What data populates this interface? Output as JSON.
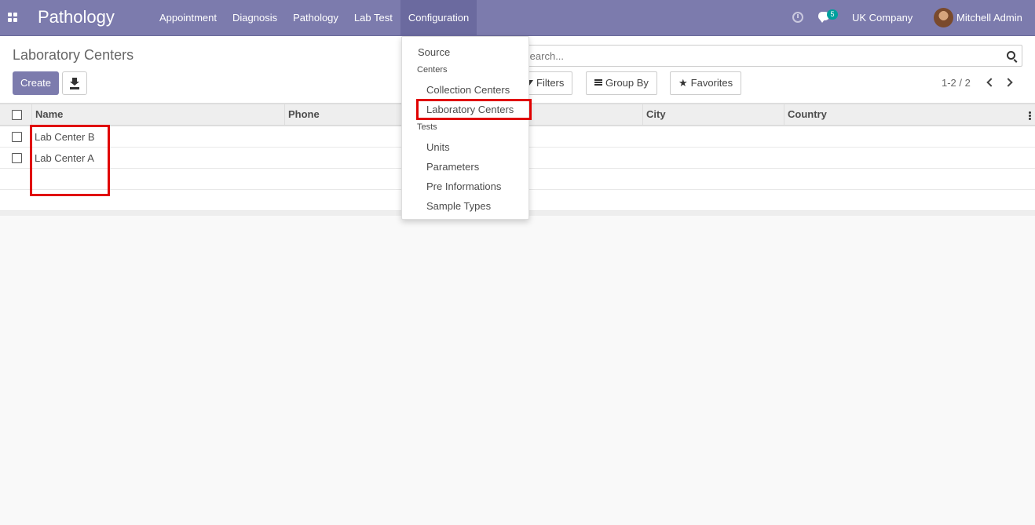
{
  "navbar": {
    "brand": "Pathology",
    "menu": [
      "Appointment",
      "Diagnosis",
      "Pathology",
      "Lab Test",
      "Configuration"
    ],
    "active_menu": "Configuration",
    "chat_count": "5",
    "company": "UK Company",
    "user": "Mitchell Admin",
    "accent_color": "#7c7bad"
  },
  "control": {
    "title": "Laboratory Centers",
    "create_label": "Create",
    "search_placeholder": "Search...",
    "filters_label": "Filters",
    "groupby_label": "Group By",
    "favorites_label": "Favorites",
    "pager": "1-2 / 2"
  },
  "table": {
    "columns": [
      "Name",
      "Phone",
      "City",
      "Country"
    ],
    "rows": [
      {
        "name": "Lab Center B"
      },
      {
        "name": "Lab Center A"
      }
    ]
  },
  "dropdown": {
    "source": "Source",
    "centers_header": "Centers",
    "collection_centers": "Collection Centers",
    "laboratory_centers": "Laboratory Centers",
    "tests_header": "Tests",
    "units": "Units",
    "parameters": "Parameters",
    "pre_informations": "Pre Informations",
    "sample_types": "Sample Types"
  },
  "highlight_color": "#e00000"
}
